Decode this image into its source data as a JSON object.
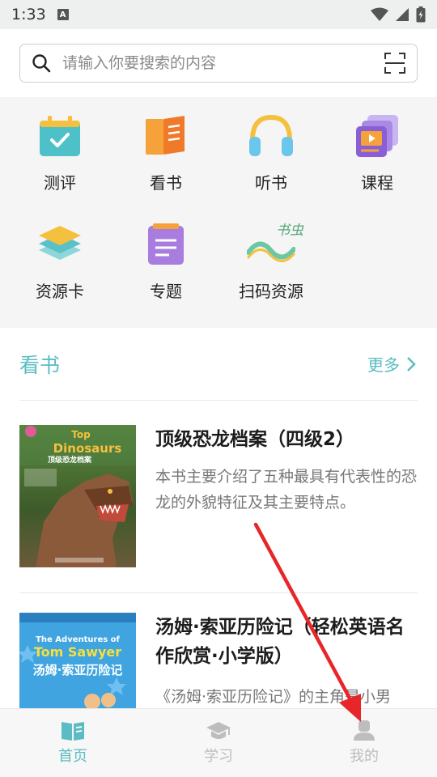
{
  "status_bar": {
    "time": "1:33",
    "notification_badge": "A"
  },
  "search": {
    "placeholder": "请输入你要搜索的内容"
  },
  "grid": {
    "items": [
      {
        "label": "测评",
        "icon": "calendar-check-icon"
      },
      {
        "label": "看书",
        "icon": "open-book-icon"
      },
      {
        "label": "听书",
        "icon": "headphones-icon"
      },
      {
        "label": "课程",
        "icon": "video-course-icon"
      },
      {
        "label": "资源卡",
        "icon": "layers-icon"
      },
      {
        "label": "专题",
        "icon": "notepad-icon"
      },
      {
        "label": "扫码资源",
        "icon": "bookworm-logo-icon"
      }
    ],
    "bookworm_logo_text": "书虫"
  },
  "section": {
    "title": "看书",
    "more_label": "更多"
  },
  "books": [
    {
      "title": "顶级恐龙档案（四级2）",
      "description": "本书主要介绍了五种最具有代表性的恐龙的外貌特征及其主要特点。",
      "cover_title_en": "Top Dinosaurs",
      "cover_title_cn": "顶级恐龙档案"
    },
    {
      "title": "汤姆·索亚历险记（轻松英语名作欣赏·小学版）",
      "description": "《汤姆·索亚历险记》的主角是小男",
      "cover_title_en": "The Adventures of Tom Sawyer",
      "cover_title_cn": "汤姆·索亚历险记"
    }
  ],
  "bottom_nav": {
    "items": [
      {
        "label": "首页",
        "icon": "book-home-icon",
        "active": true
      },
      {
        "label": "学习",
        "icon": "graduation-cap-icon",
        "active": false
      },
      {
        "label": "我的",
        "icon": "user-icon",
        "active": false
      }
    ]
  },
  "colors": {
    "accent": "#5bbdc3",
    "annotation_arrow": "#e8262a"
  }
}
